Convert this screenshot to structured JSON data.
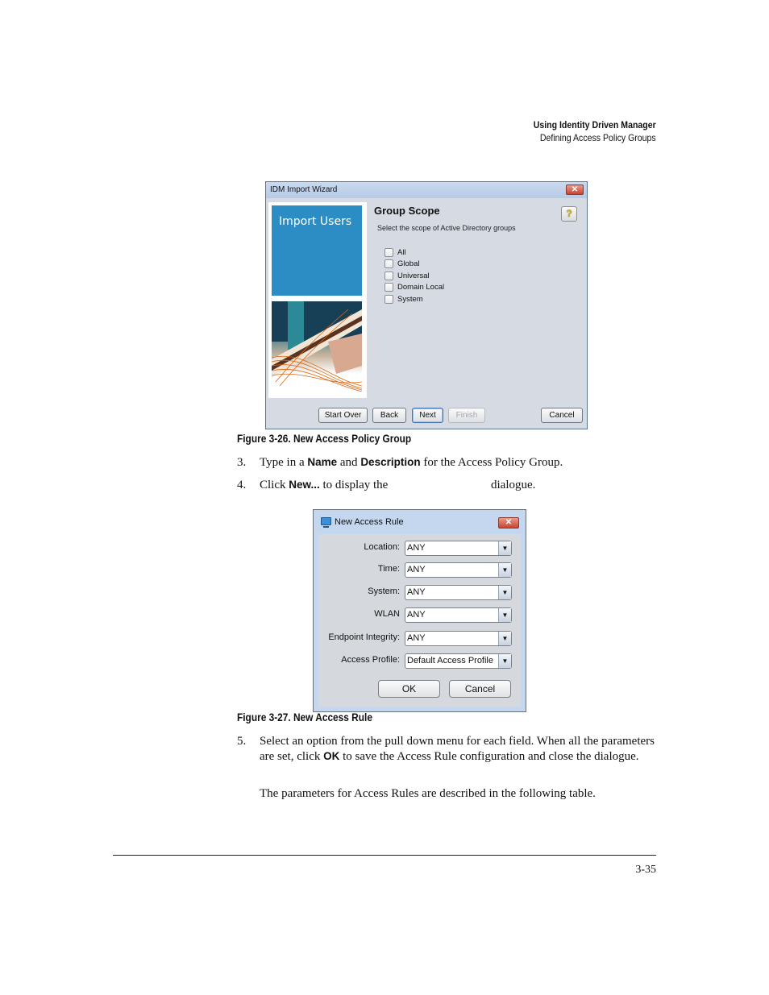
{
  "header": {
    "chapter": "Using Identity Driven Manager",
    "section": "Defining Access Policy Groups"
  },
  "wizard": {
    "title": "IDM Import Wizard",
    "banner_text": "Import Users",
    "heading": "Group Scope",
    "subtitle": "Select the scope of Active Directory groups",
    "help_icon": "question-mark-icon",
    "options": [
      {
        "label": "All",
        "checked": false
      },
      {
        "label": "Global",
        "checked": false
      },
      {
        "label": "Universal",
        "checked": false
      },
      {
        "label": "Domain Local",
        "checked": false
      },
      {
        "label": "System",
        "checked": false
      }
    ],
    "buttons": {
      "start_over": "Start Over",
      "back": "Back",
      "next": "Next",
      "finish": "Finish",
      "cancel": "Cancel"
    }
  },
  "figure1_caption": "Figure 3-26. New Access Policy Group",
  "steps": {
    "s3": {
      "num": "3.",
      "pre": "Type in a ",
      "b1": "Name",
      "mid": " and ",
      "b2": "Description",
      "post": " for the Access Policy Group."
    },
    "s4": {
      "num": "4.",
      "pre": "Click ",
      "b1": "New...",
      "mid": " to display the",
      "post": "dialogue."
    },
    "s5": {
      "num": "5.",
      "pre": "Select an option from the pull down menu for each field. When all the parameters are set, click ",
      "b1": "OK",
      "post": " to save the Access Rule configuration and close the dialogue."
    },
    "s5b": "The parameters for Access Rules are described in the following table."
  },
  "rule_dialog": {
    "title": "New Access Rule",
    "fields": [
      {
        "label": "Location:",
        "value": "ANY"
      },
      {
        "label": "Time:",
        "value": "ANY"
      },
      {
        "label": "System:",
        "value": "ANY"
      },
      {
        "label": "WLAN",
        "value": "ANY"
      },
      {
        "label": "Endpoint Integrity:",
        "value": "ANY"
      },
      {
        "label": "Access Profile:",
        "value": "Default Access Profile"
      }
    ],
    "ok": "OK",
    "cancel": "Cancel"
  },
  "figure2_caption": "Figure 3-27. New Access Rule",
  "footer": {
    "page_number": "3-35"
  }
}
